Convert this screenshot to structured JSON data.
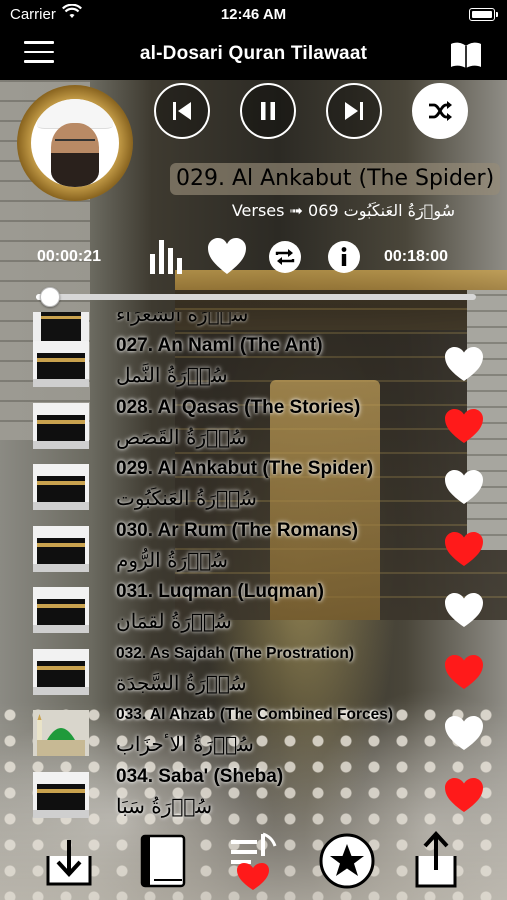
{
  "status": {
    "carrier": "Carrier",
    "time": "12:46 AM"
  },
  "nav": {
    "title": "al-Dosari Quran Tilawaat"
  },
  "player": {
    "now_playing": "029. Al Ankabut (The Spider)",
    "verses_text": "Verses ➟ 069 سُوۡرَةُ العَنکَبُوت",
    "elapsed": "00:00:21",
    "duration": "00:18:00",
    "progress_fraction": 0.019
  },
  "list": {
    "partial_top_arabic": "سُوۡرَةُ الشُّعَرَاء",
    "items": [
      {
        "en": "027. An Naml (The Ant)",
        "ar": "سُوۡرَةُ النَّمل",
        "favorite": false,
        "thumb": "kaaba-icon"
      },
      {
        "en": "028. Al Qasas (The Stories)",
        "ar": "سُوۡرَةُ القَصَص",
        "favorite": true,
        "thumb": "kaaba-icon"
      },
      {
        "en": "029. Al Ankabut (The Spider)",
        "ar": "سُوۡرَةُ العَنکَبُوت",
        "favorite": false,
        "thumb": "kaaba-icon"
      },
      {
        "en": "030. Ar Rum (The Romans)",
        "ar": "سُوۡرَةُ الرُّوم",
        "favorite": true,
        "thumb": "kaaba-icon"
      },
      {
        "en": "031. Luqman (Luqman)",
        "ar": "سُوۡرَةُ لقمَان",
        "favorite": false,
        "thumb": "kaaba-icon"
      },
      {
        "en": "032. As Sajdah (The Prostration)",
        "ar": "سُوۡرَةُ السَّجدَة",
        "favorite": true,
        "thumb": "kaaba-icon"
      },
      {
        "en": "033. Al Ahzab (The Combined Forces)",
        "ar": "سُوۡرَةُ الاٴحزَاب",
        "favorite": false,
        "thumb": "mosque-icon"
      },
      {
        "en": "034. Saba' (Sheba)",
        "ar": "سُوۡرَةُ سَبَا",
        "favorite": true,
        "thumb": "kaaba-icon"
      }
    ]
  },
  "colors": {
    "fav_red": "#ff1a1a",
    "fav_white": "#ffffff",
    "nav_bg": "#000000"
  },
  "tabs": [
    {
      "icon": "download-icon"
    },
    {
      "icon": "book-icon"
    },
    {
      "icon": "favorite-list-icon"
    },
    {
      "icon": "star-circle-icon"
    },
    {
      "icon": "share-icon"
    }
  ]
}
